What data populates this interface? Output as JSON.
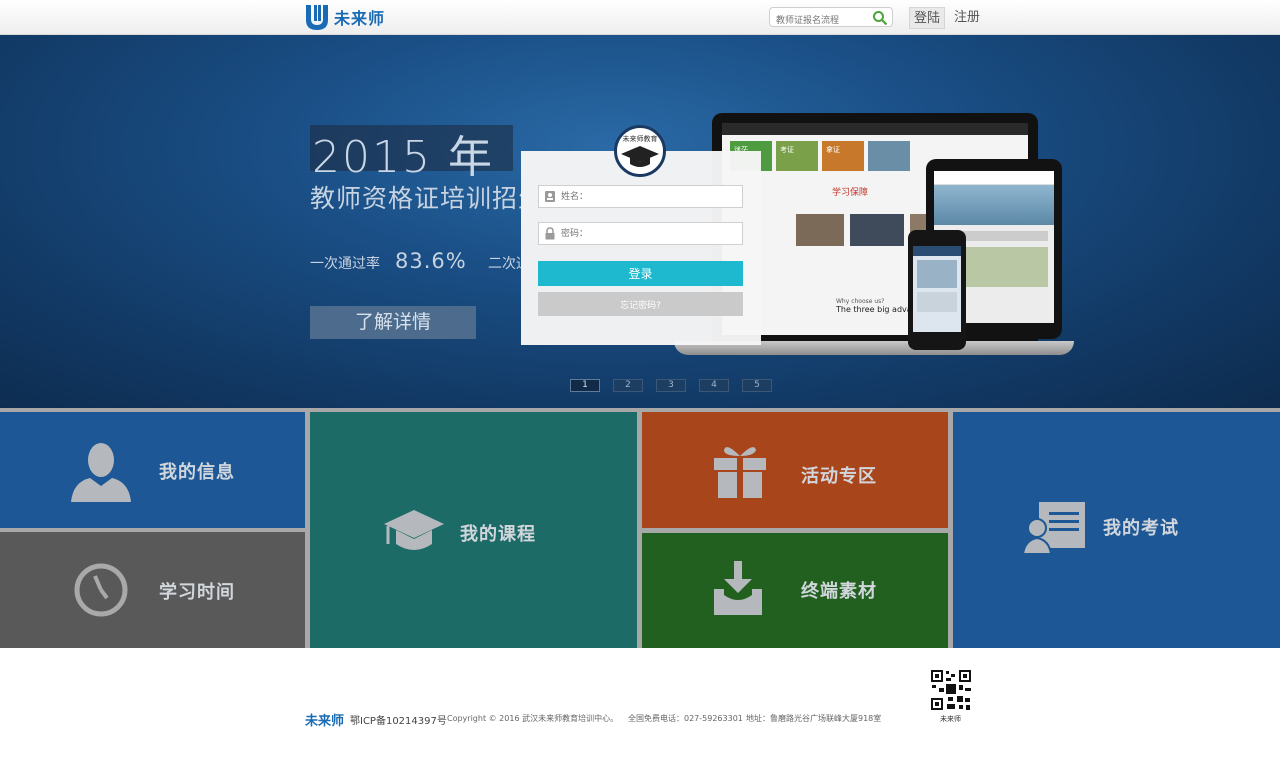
{
  "header": {
    "logo_text": "未来师",
    "search_placeholder": "教师证报名流程",
    "login_label": "登陆",
    "register_label": "注册"
  },
  "banner": {
    "year": "2015 年",
    "subtitle": "教师资格证培训招生",
    "rate_label": "一次通过率",
    "rate_value": "83.6%",
    "rate2_label": "二次通过率",
    "detail_button": "了解详情",
    "pages": [
      "1",
      "2",
      "3",
      "4",
      "5"
    ],
    "active_page": 0,
    "device_tiles": [
      "迷茫",
      "考证",
      "拿证"
    ],
    "device_heading": "学习保障",
    "device_caption1": "Why choose us?",
    "device_caption2": "The three big advantages"
  },
  "login": {
    "badge_text": "未来师教育",
    "name_placeholder": "姓名：",
    "password_placeholder": "密码：",
    "login_button": "登录",
    "forgot_button": "忘记密码?"
  },
  "tiles": {
    "my_info": "我的信息",
    "study_time": "学习时间",
    "my_courses": "我的课程",
    "activities": "活动专区",
    "terminal": "终端素材",
    "my_exam": "我的考试"
  },
  "colors": {
    "info": "#1d5795",
    "time": "#595959",
    "courses": "#1d6b67",
    "activities": "#a9451b",
    "terminal": "#22601f",
    "exam": "#1d5795",
    "login_accent": "#1eb9cf"
  },
  "footer": {
    "logo_text": "未来师",
    "icp": "鄂ICP备10214397号",
    "copyright": "Copyright © 2016 武汉未来师教育培训中心。",
    "phone": "全国免费电话：027-59263301",
    "address": "地址：鲁磨路光谷广场联峰大厦918室",
    "qr_caption": "未来师"
  }
}
